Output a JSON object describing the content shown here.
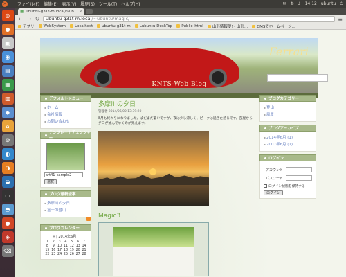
{
  "system": {
    "menus": [
      "ファイル(F)",
      "編集(E)",
      "表示(V)",
      "履歴(S)",
      "ツール(T)",
      "ヘルプ(H)"
    ],
    "time": "14:12",
    "user": "ubuntu"
  },
  "browser": {
    "tab_title": "ubuntu-g31t-m.local/~ub",
    "url_host": "ubuntu-g31t-m.local",
    "url_path": "/~ubuntu/magic/",
    "bookmarks": [
      "アプリ",
      "WebSystem",
      "Localhost",
      "ubuntu-g31t-m",
      "Lubuntu-DeskTop",
      "Public_html",
      "山形情報便! - 山形...",
      "CMSでホームページ..."
    ]
  },
  "site": {
    "logo_text": "Ferrari",
    "blog_title": "KNTS-Web Blog"
  },
  "left": {
    "menu_title": "デフォルトメニュー",
    "menu_links": [
      "ホーム",
      "会社情報",
      "お問い合わせ"
    ],
    "template_title": "テンプレートチェンジャー",
    "template_select": "art41_sample2",
    "template_button": "選択",
    "recent_title": "ブログ最新記事",
    "recent_links": [
      "多摩川の夕日",
      "富士の登山"
    ],
    "calendar_title": "ブログカレンダー",
    "calendar_caption": "| 2014年6月 |",
    "calendar_prefix": "«",
    "calendar_rows": [
      [
        "1",
        "2",
        "3",
        "4",
        "5",
        "6",
        "7"
      ],
      [
        "8",
        "9",
        "10",
        "11",
        "12",
        "13",
        "14"
      ],
      [
        "15",
        "16",
        "17",
        "18",
        "19",
        "20",
        "21"
      ],
      [
        "22",
        "23",
        "24",
        "25",
        "26",
        "27",
        "28"
      ]
    ]
  },
  "post": {
    "title": "多摩川の夕日",
    "meta": "管理者 2014/06/02 13:39:20",
    "text": "8月も終わりになりました。まだまだ暑いですが、夜は少し涼しく、ピークは過ぎた感じです。部屋から夕日が沈んでゆくのが見えます。",
    "second_title": "Magic3"
  },
  "right": {
    "category_title": "ブログカテゴリー",
    "category_links": [
      "登山",
      "風景"
    ],
    "archive_title": "ブログアーカイブ",
    "archive_links": [
      "2014年6月 (1)",
      "2007年6月 (1)"
    ],
    "login_title": "ログイン",
    "account_label": "アカウント",
    "password_label": "パスワード",
    "remember_label": "ログイン状態を保持する",
    "login_button": "ログイン"
  }
}
